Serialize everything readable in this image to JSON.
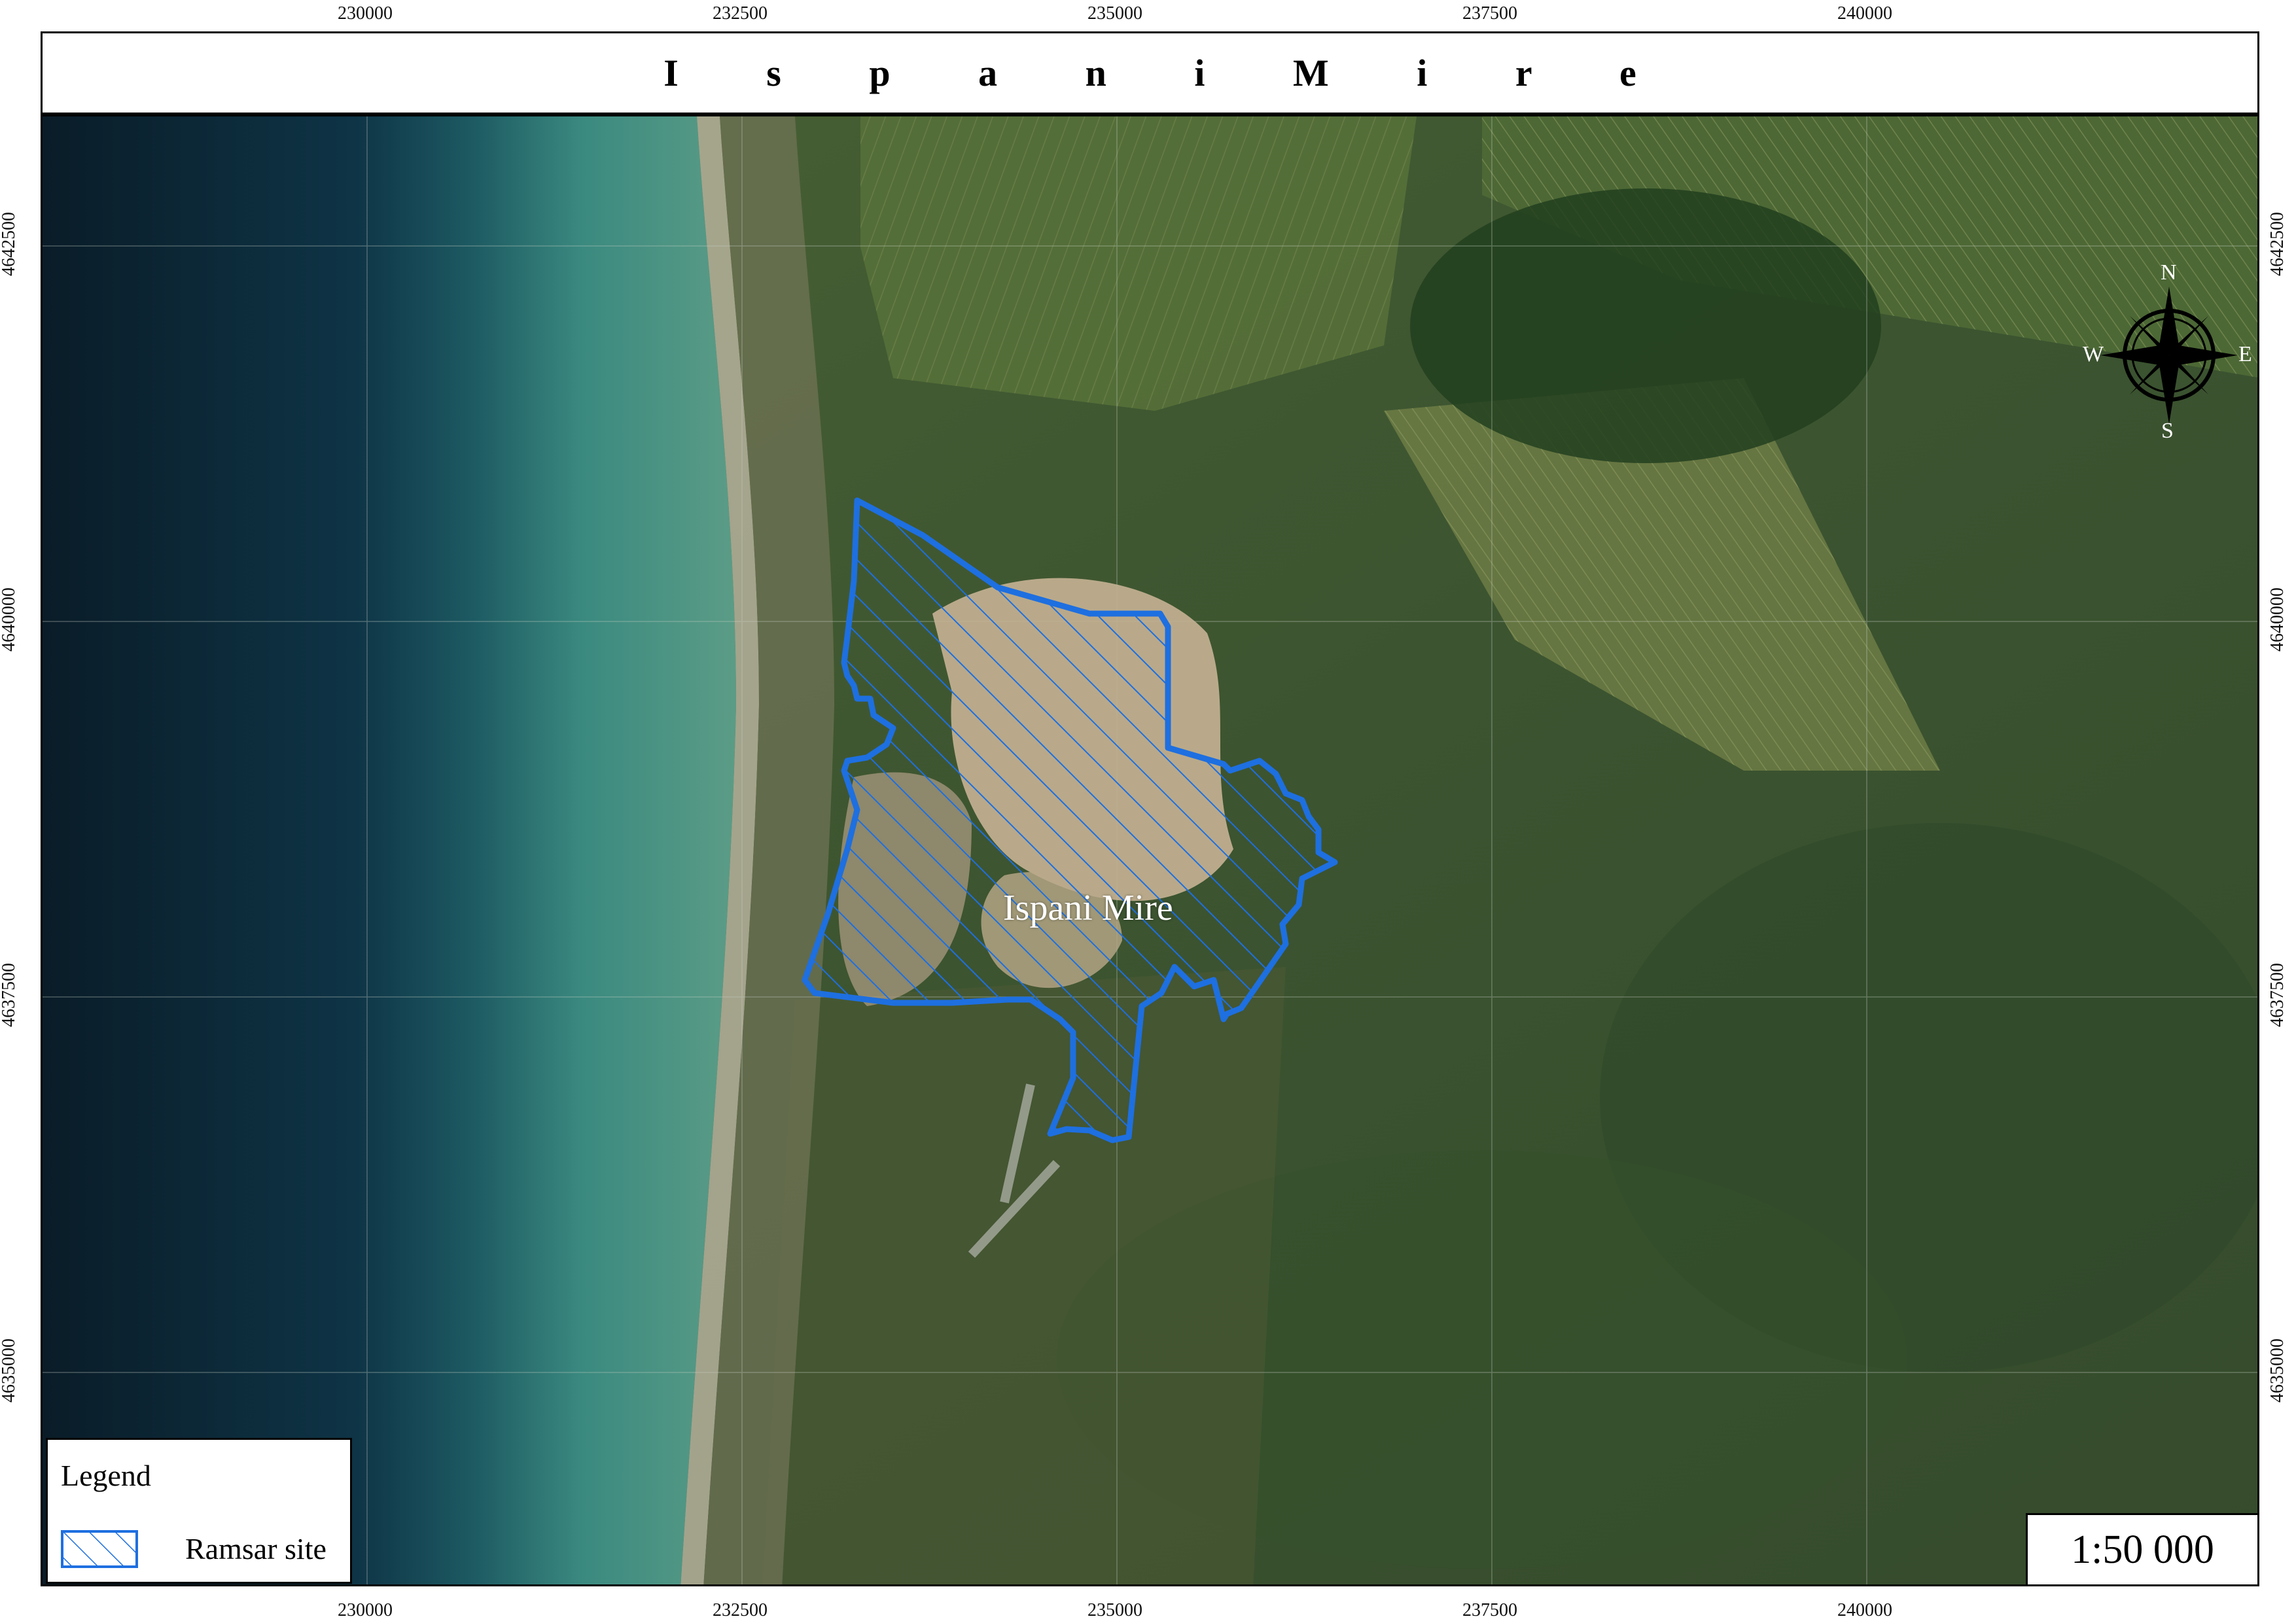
{
  "title": "I s p a n i   M i r e",
  "map": {
    "site_label": "Ispani Mire",
    "scale": "1:50 000",
    "colors": {
      "sea_deep": "#0b2433",
      "sea_shallow": "#2f7f78",
      "land": "#3d5a32",
      "boundary": "#1e6fe0",
      "mire": "#b8a78c"
    }
  },
  "grid": {
    "x_ticks": [
      "230000",
      "232500",
      "235000",
      "237500",
      "240000"
    ],
    "y_ticks": [
      "4642500",
      "4640000",
      "4637500",
      "4635000"
    ]
  },
  "legend": {
    "title": "Legend",
    "items": [
      {
        "label": "Ramsar site",
        "symbol": "hatched-polygon"
      }
    ]
  },
  "compass": {
    "n": "N",
    "e": "E",
    "s": "S",
    "w": "W"
  }
}
